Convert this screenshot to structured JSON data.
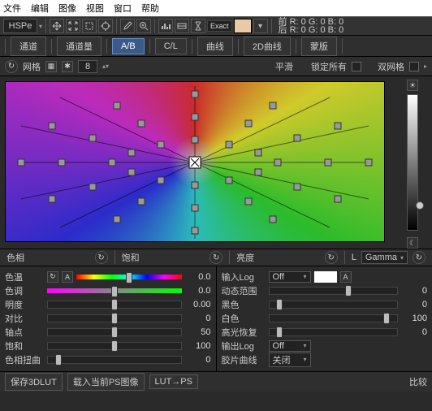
{
  "menu": {
    "file": "文件",
    "edit": "编辑",
    "image": "图像",
    "view": "视图",
    "window": "窗口",
    "help": "帮助"
  },
  "toolbar": {
    "mode": "HSPe",
    "exact": "Exact",
    "info_front": "前  R: 0    G: 0    B: 0",
    "info_back": "后  R: 0    G: 0    B: 0"
  },
  "tabs": {
    "channel": "通道",
    "channel_amt": "通道量",
    "ab": "A/B",
    "cl": "C/L",
    "curve": "曲线",
    "curve2d": "2D曲线",
    "mask": "蒙版"
  },
  "subrow": {
    "grid": "网格",
    "rings": "8",
    "smooth": "平滑",
    "lock_all": "锁定所有",
    "dual_grid": "双网格"
  },
  "axis": {
    "hue": "色相",
    "sat": "饱和",
    "lum": "亮度",
    "l_short": "L",
    "gamma": "Gamma"
  },
  "left_panel": {
    "rows": [
      {
        "label": "色温",
        "value": "0.0",
        "pos": 50,
        "track": "hue",
        "extra_btn": "A"
      },
      {
        "label": "色调",
        "value": "0.0",
        "pos": 50,
        "track": "mg"
      },
      {
        "label": "明度",
        "value": "0.00",
        "pos": 50
      },
      {
        "label": "对比",
        "value": "0",
        "pos": 50
      },
      {
        "label": "轴点",
        "value": "50",
        "pos": 50
      },
      {
        "label": "饱和",
        "value": "100",
        "pos": 50
      },
      {
        "label": "色相扭曲",
        "value": "0",
        "pos": 8
      }
    ]
  },
  "right_panel": {
    "input_log": {
      "label": "输入Log",
      "sel": "Off",
      "btn": "A"
    },
    "rows": [
      {
        "label": "动态范围",
        "value": "0",
        "pos": 62
      },
      {
        "label": "黑色",
        "value": "0",
        "pos": 8
      },
      {
        "label": "白色",
        "value": "100",
        "pos": 92
      },
      {
        "label": "高光恢复",
        "value": "0",
        "pos": 8
      }
    ],
    "output_log": {
      "label": "输出Log",
      "sel": "Off"
    },
    "film_curve": {
      "label": "胶片曲线",
      "sel": "关闭"
    }
  },
  "footer": {
    "save": "保存3DLUT",
    "load": "载入当前PS图像",
    "lut2ps": "LUT→PS",
    "compare": "比较"
  }
}
